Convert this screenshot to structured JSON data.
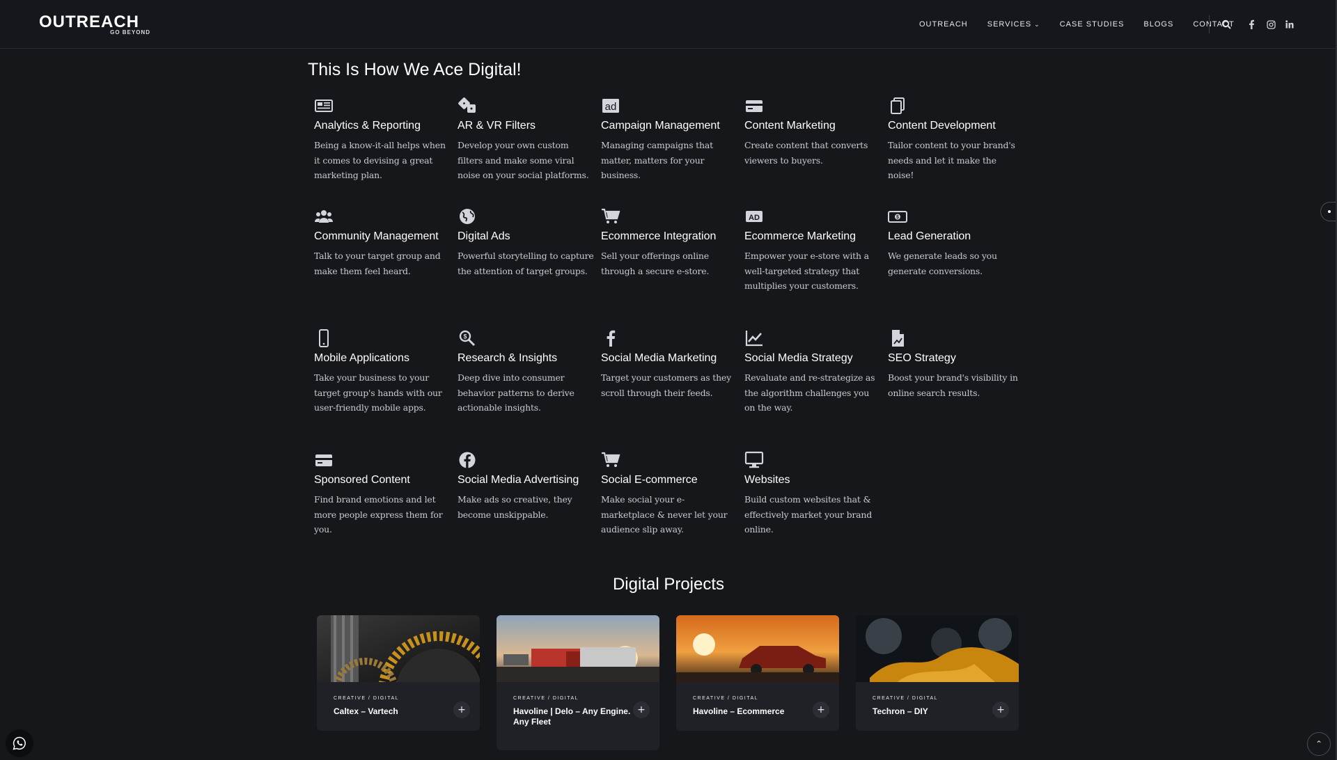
{
  "header": {
    "logo": {
      "word": "OUTREACH",
      "tagline": "GO BEYOND"
    },
    "nav": [
      {
        "label": "OUTREACH"
      },
      {
        "label": "SERVICES",
        "has_dropdown": true
      },
      {
        "label": "CASE STUDIES"
      },
      {
        "label": "BLOGS"
      },
      {
        "label": "CONTACT"
      }
    ],
    "icons": [
      "search-icon",
      "facebook-icon",
      "instagram-icon",
      "linkedin-icon"
    ]
  },
  "services_section": {
    "title": "This Is How We Ace Digital!",
    "items": [
      {
        "icon": "newspaper-icon",
        "title": "Analytics & Reporting",
        "desc": "Being a know-it-all helps when it comes to devising a great marketing plan."
      },
      {
        "icon": "dice-icon",
        "title": "AR & VR Filters",
        "desc": "Develop your own custom filters and make some viral noise on your social platforms."
      },
      {
        "icon": "ad-icon",
        "title": "Campaign Management",
        "desc": "Managing campaigns that matter, matters for your business."
      },
      {
        "icon": "card-icon",
        "title": "Content Marketing",
        "desc": "Create content that converts viewers to buyers."
      },
      {
        "icon": "copy-icon",
        "title": "Content Development",
        "desc": "Tailor content to your brand's needs and let it make the noise!"
      },
      {
        "icon": "users-icon",
        "title": "Community Management",
        "desc": "Talk to your target group and make them feel heard."
      },
      {
        "icon": "globe-icon",
        "title": "Digital Ads",
        "desc": "Powerful storytelling to capture the attention of target groups."
      },
      {
        "icon": "cart-icon",
        "title": "Ecommerce Integration",
        "desc": "Sell your offerings online through a secure e-store."
      },
      {
        "icon": "ad-badge-icon",
        "title": "Ecommerce Marketing",
        "desc": "Empower your e-store with a well-targeted strategy that multiplies your customers."
      },
      {
        "icon": "money-bill-icon",
        "title": "Lead Generation",
        "desc": "We generate leads so you generate conversions."
      },
      {
        "icon": "mobile-icon",
        "title": "Mobile Applications",
        "desc": "Take your business to your target group's hands with our user-friendly mobile apps."
      },
      {
        "icon": "search-dollar-icon",
        "title": "Research & Insights",
        "desc": "Deep dive into consumer behavior patterns to derive actionable insights."
      },
      {
        "icon": "facebook-f-icon",
        "title": "Social Media Marketing",
        "desc": "Target your customers as they scroll through their feeds."
      },
      {
        "icon": "chart-line-icon",
        "title": "Social Media Strategy",
        "desc": "Revaluate and re-strategize as the algorithm challenges you on the way."
      },
      {
        "icon": "file-chart-icon",
        "title": "SEO Strategy",
        "desc": "Boost your brand's visibility in online search results."
      },
      {
        "icon": "card-icon",
        "title": "Sponsored Content",
        "desc": "Find brand emotions and let more people express them for you."
      },
      {
        "icon": "facebook-circle-icon",
        "title": "Social Media Advertising",
        "desc": "Make ads so creative, they become unskippable."
      },
      {
        "icon": "cart-icon",
        "title": "Social E-commerce",
        "desc": "Make social your e-marketplace & never let your audience slip away."
      },
      {
        "icon": "desktop-icon",
        "title": "Websites",
        "desc": "Build custom websites that & effectively market your brand online."
      }
    ]
  },
  "projects_section": {
    "title": "Digital Projects",
    "cards": [
      {
        "category": "CREATIVE / DIGITAL",
        "name": "Caltex – Vartech",
        "image": "gears-image"
      },
      {
        "category": "CREATIVE / DIGITAL",
        "name": "Havoline | Delo – Any Engine. Any Fleet",
        "image": "trucks-image"
      },
      {
        "category": "CREATIVE / DIGITAL",
        "name": "Havoline – Ecommerce",
        "image": "car-sunset-image"
      },
      {
        "category": "CREATIVE / DIGITAL",
        "name": "Techron – DIY",
        "image": "oil-engine-image"
      }
    ]
  },
  "floating": {
    "whatsapp_icon": "whatsapp-icon",
    "back_to_top_icon": "arrow-up-icon"
  }
}
